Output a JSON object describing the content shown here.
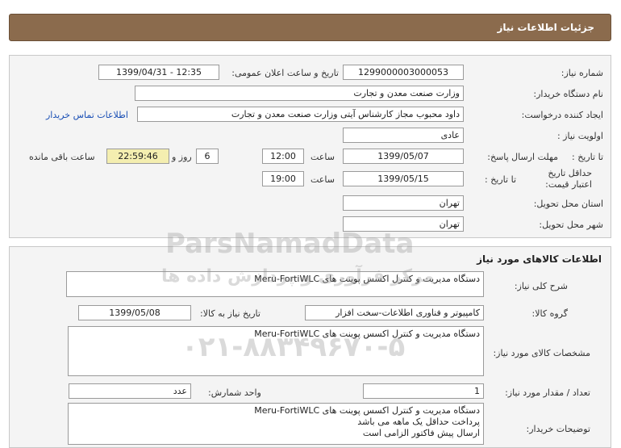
{
  "header": {
    "title": "جزئیات اطلاعات نیاز"
  },
  "info": {
    "need_number_label": "شماره نیاز:",
    "need_number": "1299000003000053",
    "announce_label": "تاریخ و ساعت اعلان عمومی:",
    "announce_value": "1399/04/31 - 12:35",
    "buyer_org_label": "نام دستگاه خریدار:",
    "buyer_org": "وزارت صنعت معدن و تجارت",
    "requester_label": "ایجاد کننده درخواست:",
    "requester": "داود محبوب مجاز کارشناس آیتی وزارت صنعت معدن و تجارت",
    "contact_link": "اطلاعات تماس خریدار",
    "priority_label": "اولویت نیاز :",
    "priority": "عادی",
    "deadline_label": "مهلت ارسال پاسخ:",
    "to_date_label": "تا تاریخ :",
    "deadline_date": "1399/05/07",
    "time_label": "ساعت",
    "deadline_time": "12:00",
    "days": "6",
    "days_suffix": "روز و",
    "remaining_time": "22:59:46",
    "remaining_label": "ساعت باقی مانده",
    "price_validity_label": "حداقل تاریخ اعتبار قیمت:",
    "price_date": "1399/05/15",
    "price_time": "19:00",
    "province_label": "استان محل تحویل:",
    "province": "تهران",
    "city_label": "شهر محل تحویل:",
    "city": "تهران"
  },
  "goods": {
    "section_title": "اطلاعات کالاهای مورد نیاز",
    "general_desc_label": "شرح کلی نیاز:",
    "general_desc": "دستگاه مدیریت و کنترل اکسس پوینت های Meru-FortiWLC",
    "group_label": "گروه کالا:",
    "group": "کامپیوتر و فناوری اطلاعات-سخت افزار",
    "need_date_label": "تاریخ نیاز به کالا:",
    "need_date": "1399/05/08",
    "specs_label": "مشخصات کالای مورد نیاز:",
    "specs": "دستگاه مدیریت و کنترل اکسس پوینت های Meru-FortiWLC",
    "qty_label": "تعداد / مقدار مورد نیاز:",
    "qty": "1",
    "unit_label": "واحد شمارش:",
    "unit": "عدد",
    "buyer_notes_label": "توضیحات خریدار:",
    "buyer_notes": [
      "دستگاه مدیریت و کنترل اکسس پوینت های Meru-FortiWLC",
      "پرداخت حداقل یک ماهه می باشد",
      "ارسال پیش فاکتور الزامی است"
    ]
  },
  "watermark": {
    "brand": "ParsNamadData",
    "tagline": "مرکز فرآوری و پردازش داده ها",
    "phone": "۰۲۱-۸۸۳۴۹۶۷۰-۵"
  }
}
